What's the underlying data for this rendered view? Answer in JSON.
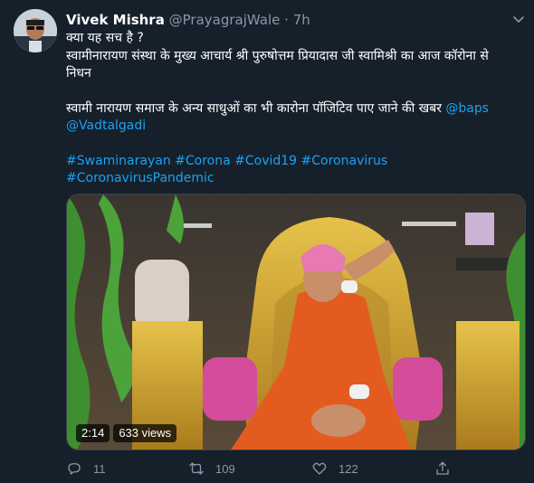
{
  "tweet": {
    "author_name": "Vivek Mishra",
    "handle": "@PrayagrajWale",
    "separator": "·",
    "time": "7h",
    "line1": "क्या यह सच है ?",
    "line2": "स्वामीनारायण संस्था के मुख्य आचार्य श्री पुरुषोत्तम प्रियादास जी स्वामिश्री का आज कॉरोना से",
    "line3": "निधन",
    "line4_text": "स्वामी नारायण समाज के अन्य साधुओं का भी कारोना पॉजिटिव पाए जाने की खबर ",
    "mention1": "@baps",
    "mention2": "@Vadtalgadi",
    "hashtags_line1": "#Swaminarayan #Corona #Covid19 #Coronavirus",
    "hashtags_line2": "#CoronavirusPandemic"
  },
  "video": {
    "duration": "2:14",
    "views": "633 views"
  },
  "actions": {
    "reply_count": "11",
    "retweet_count": "109",
    "like_count": "122"
  },
  "colors": {
    "background": "#15202b",
    "link": "#1da1f2",
    "muted": "#8899a6"
  }
}
